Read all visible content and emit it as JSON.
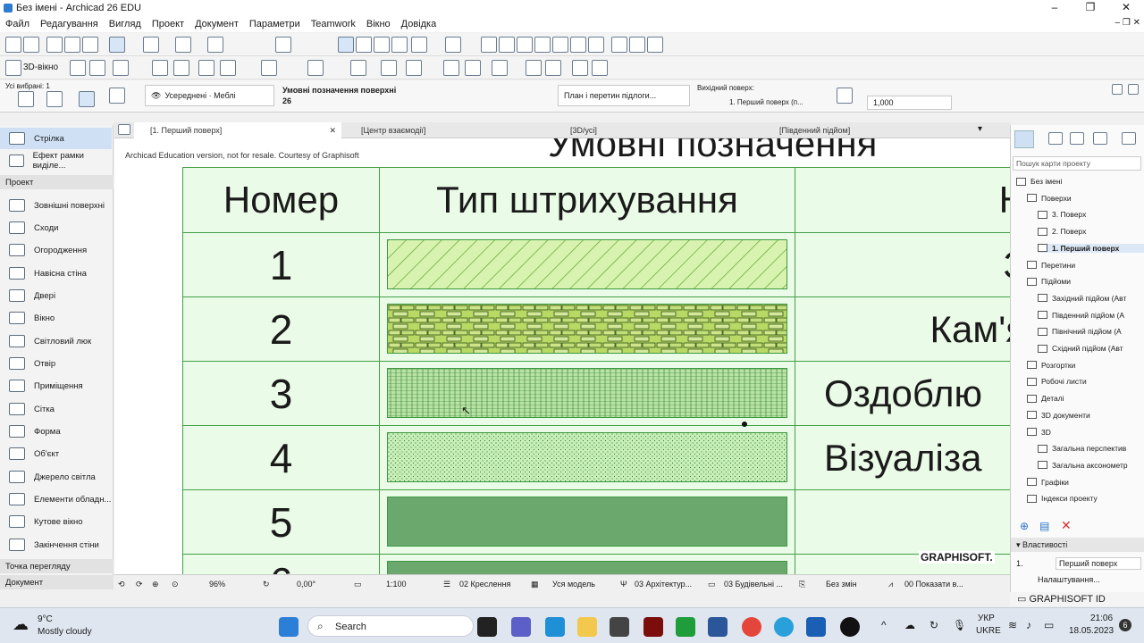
{
  "window": {
    "title": "Без імені - Archicad 26 EDU",
    "min": "–",
    "max": "❐",
    "close": "✕"
  },
  "menu": [
    "Файл",
    "Редагування",
    "Вигляд",
    "Проект",
    "Документ",
    "Параметри",
    "Teamwork",
    "Вікно",
    "Довідка"
  ],
  "toolbar2": {
    "view3d": "3D-вікно"
  },
  "infobox": {
    "selected": "Усі вибрані: 1",
    "view_mode": "Усереднені · Меблі",
    "legend_title": "Умовні позначення поверхні",
    "legend_num": "26",
    "plan_section": "План і перетин підлоги...",
    "source_label": "Вихідний поверх:",
    "source_value": "1. Перший поверх (п...",
    "scale_value": "1,000"
  },
  "left_panel": {
    "top_tools": [
      "Стрілка",
      "Ефект рамки виділе..."
    ],
    "section_project": "Проект",
    "tools": [
      "Зовнішні поверхні",
      "Сходи",
      "Огородження",
      "Навісна стіна",
      "Двері",
      "Вікно",
      "Світловий люк",
      "Отвір",
      "Приміщення",
      "Сітка",
      "Форма",
      "Об'єкт",
      "Джерело світла",
      "Елементи обладн...",
      "Кутове вікно",
      "Закінчення стіни"
    ],
    "section_view": "Точка перегляду",
    "section_doc": "Документ"
  },
  "tabs": [
    "[1. Перший поверх]",
    "[Центр взаємодії]",
    "[3D/усі]",
    "[Південний підйом]"
  ],
  "canvas": {
    "watermark": "Archicad Education version, not for resale. Courtesy of Graphisoft",
    "title_partial": "Умовні позначення",
    "col_num": "Номер",
    "col_type": "Тип штрихування",
    "col_name_partial": "Н",
    "rows": [
      {
        "n": "1",
        "desc": "З"
      },
      {
        "n": "2",
        "desc": "Кам'я"
      },
      {
        "n": "3",
        "desc": "Оздоблю"
      },
      {
        "n": "4",
        "desc": "Візуаліза"
      },
      {
        "n": "5",
        "desc": ""
      },
      {
        "n": "6",
        "desc": ""
      }
    ],
    "graphisoft": "GRAPHISOFT."
  },
  "statusbar": {
    "zoom": "96%",
    "angle": "0,00°",
    "scale": "1:100",
    "layers": "02 Креслення",
    "model": "Уся модель",
    "arch": "03 Архітектур...",
    "build": "03 Будівельні ...",
    "changes": "Без змін",
    "show": "00 Показати в..."
  },
  "right_panel": {
    "search_placeholder": "Пошук карти проекту",
    "tree": [
      {
        "label": "Без імені",
        "lvl": 0
      },
      {
        "label": "Поверхи",
        "lvl": 1
      },
      {
        "label": "3. Поверх",
        "lvl": 2
      },
      {
        "label": "2. Поверх",
        "lvl": 2
      },
      {
        "label": "1. Перший поверх",
        "lvl": 2
      },
      {
        "label": "Перетини",
        "lvl": 1
      },
      {
        "label": "Підйоми",
        "lvl": 1
      },
      {
        "label": "Західний підйом (Авт",
        "lvl": 2
      },
      {
        "label": "Південний підйом (А",
        "lvl": 2
      },
      {
        "label": "Північний підйом (А",
        "lvl": 2
      },
      {
        "label": "Східний підйом (Авт",
        "lvl": 2
      },
      {
        "label": "Розгортки",
        "lvl": 1
      },
      {
        "label": "Робочі листи",
        "lvl": 1
      },
      {
        "label": "Деталі",
        "lvl": 1
      },
      {
        "label": "3D документи",
        "lvl": 1
      },
      {
        "label": "3D",
        "lvl": 1
      },
      {
        "label": "Загальна перспектив",
        "lvl": 2
      },
      {
        "label": "Загальна аксонометр",
        "lvl": 2
      },
      {
        "label": "Графіки",
        "lvl": 1
      },
      {
        "label": "Індекси проекту",
        "lvl": 1
      }
    ],
    "properties": "Властивості",
    "prop_num": "1.",
    "prop_val": "Перший поверх",
    "settings": "Налаштування...",
    "graphisoft_id": "GRAPHISOFT ID"
  },
  "taskbar": {
    "weather_temp": "9°C",
    "weather_text": "Mostly cloudy",
    "search": "Search",
    "lang1": "УКР",
    "lang2": "UKRE",
    "time": "21:06",
    "date": "18.05.2023",
    "badge": "6"
  }
}
